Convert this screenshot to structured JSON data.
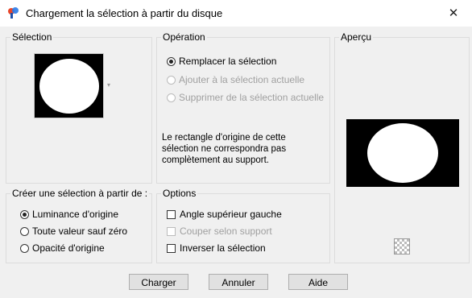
{
  "window": {
    "title": "Chargement la sélection à partir du disque",
    "close_glyph": "✕"
  },
  "selection_group": {
    "label": "Sélection"
  },
  "operation_group": {
    "label": "Opération",
    "options": [
      {
        "label": "Remplacer la sélection",
        "checked": true,
        "enabled": true
      },
      {
        "label": "Ajouter à la sélection actuelle",
        "checked": false,
        "enabled": false
      },
      {
        "label": "Supprimer de la sélection actuelle",
        "checked": false,
        "enabled": false
      }
    ],
    "warning": "Le rectangle d'origine de cette\nsélection ne correspondra pas\ncomplètement au support."
  },
  "preview_group": {
    "label": "Aperçu"
  },
  "create_group": {
    "label": "Créer une sélection à partir de :",
    "options": [
      {
        "label": "Luminance d'origine",
        "checked": true
      },
      {
        "label": "Toute valeur sauf zéro",
        "checked": false
      },
      {
        "label": "Opacité d'origine",
        "checked": false
      }
    ]
  },
  "options_group": {
    "label": "Options",
    "checkboxes": [
      {
        "label": "Angle supérieur gauche",
        "checked": false,
        "enabled": true
      },
      {
        "label": "Couper selon support",
        "checked": false,
        "enabled": false
      },
      {
        "label": "Inverser la sélection",
        "checked": false,
        "enabled": true
      }
    ]
  },
  "buttons": {
    "load": "Charger",
    "cancel": "Annuler",
    "help": "Aide"
  }
}
